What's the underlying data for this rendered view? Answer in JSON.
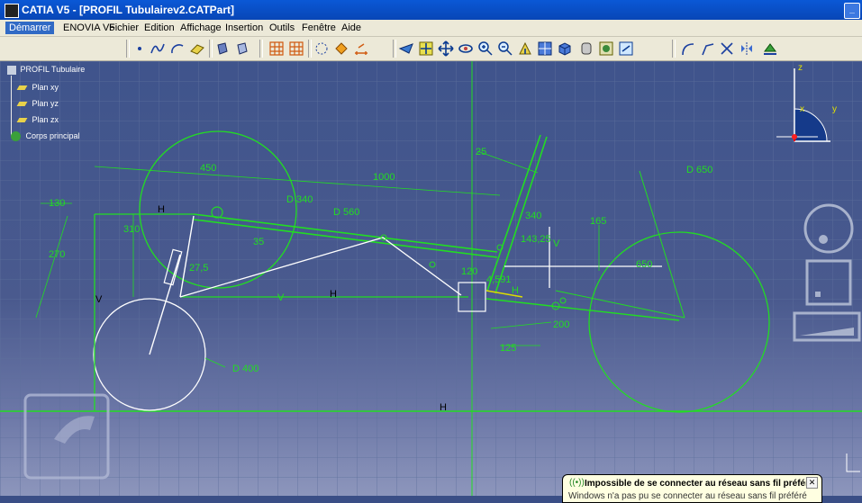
{
  "window": {
    "title": "CATIA V5 - [PROFIL Tubulairev2.CATPart]"
  },
  "menu": [
    "Démarrer",
    "ENOVIA V5",
    "Fichier",
    "Edition",
    "Affichage",
    "Insertion",
    "Outils",
    "Fenêtre",
    "Aide"
  ],
  "tree": {
    "root": "PROFIL Tubulaire",
    "items": [
      "Plan xy",
      "Plan yz",
      "Plan zx",
      "Corps principal"
    ]
  },
  "sketch": {
    "dimensions": [
      "25",
      "1000",
      "450",
      "D 560",
      "D 340",
      "130",
      "310",
      "270",
      "35",
      "27,5",
      "340",
      "165",
      "143,25",
      "650",
      "D 650",
      "120",
      "4,591",
      "125",
      "200",
      "D 400"
    ],
    "constraints": [
      "H",
      "H",
      "H",
      "H",
      "V",
      "V",
      "V"
    ]
  },
  "compass": {
    "z": "z",
    "y": "y",
    "x": "x"
  },
  "notification": {
    "title": "Impossible de se connecter au réseau sans fil préféré",
    "message": "Windows n'a pas pu se connecter au réseau sans fil préféré",
    "close": "✕"
  },
  "colors": {
    "sketch_green": "#22dd22",
    "sketch_white": "#ffffff",
    "title_blue": "#0a58d6"
  }
}
